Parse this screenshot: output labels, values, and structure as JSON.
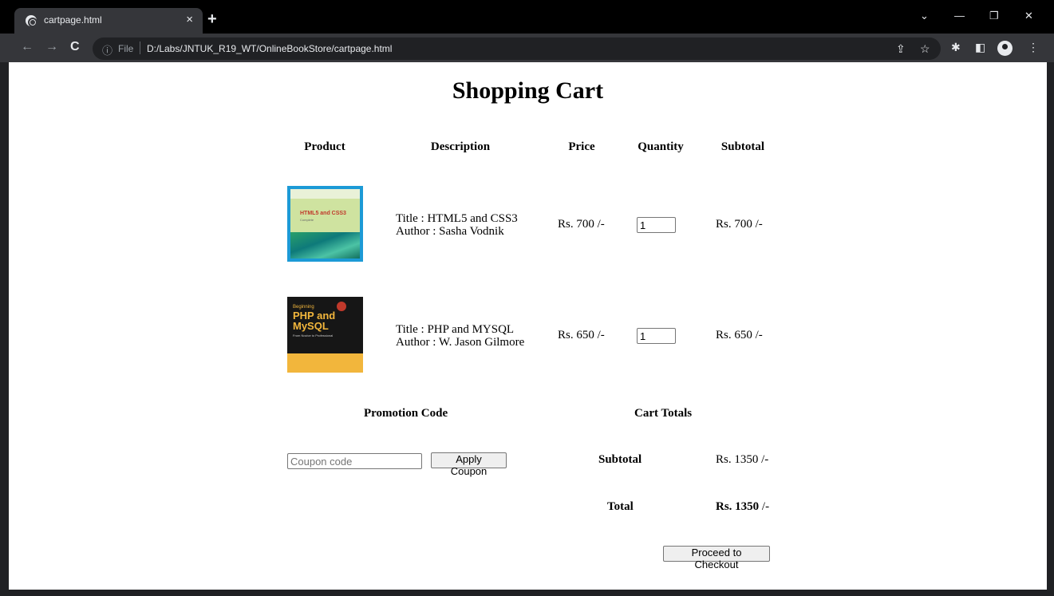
{
  "browser": {
    "tab_title": "cartpage.html",
    "tab_close": "×",
    "new_tab": "+",
    "scheme_label": "File",
    "url": "D:/Labs/JNTUK_R19_WT/OnlineBookStore/cartpage.html",
    "window_controls": {
      "dropdown": "⌄",
      "minimize": "—",
      "restore": "❐",
      "close": "✕"
    }
  },
  "page": {
    "title": "Shopping Cart",
    "columns": [
      "Product",
      "Description",
      "Price",
      "Quantity",
      "Subtotal"
    ],
    "items": [
      {
        "title_line": "Title : HTML5 and CSS3",
        "author_line": "Author : Sasha Vodnik",
        "price": "Rs. 700 /-",
        "quantity": "1",
        "subtotal": "Rs. 700 /-",
        "cover_text": "HTML5 and CSS3",
        "cover_subtext": "Complete"
      },
      {
        "title_line": "Title : PHP and MYSQL",
        "author_line": "Author : W. Jason Gilmore",
        "price": "Rs. 650 /-",
        "quantity": "1",
        "subtotal": "Rs. 650 /-",
        "cover_text_1": "Beginning",
        "cover_text_2": "PHP and",
        "cover_text_3": "MySQL",
        "cover_subtext": "From Novice to Professional"
      }
    ],
    "promotion": {
      "heading": "Promotion Code",
      "coupon_placeholder": "Coupon code",
      "apply_label": "Apply Coupon"
    },
    "totals": {
      "heading": "Cart Totals",
      "subtotal_label": "Subtotal",
      "subtotal_value": "Rs. 1350 /-",
      "total_label": "Total",
      "total_value_bold": "Rs. 1350",
      "total_value_suffix": " /-",
      "checkout_label": "Proceed to Checkout"
    }
  }
}
